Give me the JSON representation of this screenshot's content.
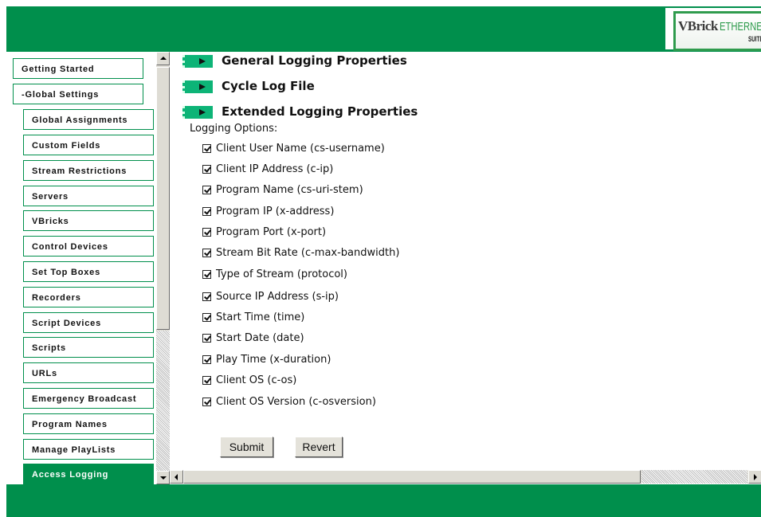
{
  "header": {
    "logo_brand": "VBrick",
    "logo_product": "ETHERNET",
    "logo_suite": "SUITE"
  },
  "sidebar": {
    "items": [
      {
        "label": "Getting Started"
      },
      {
        "label": "-Global Settings"
      },
      {
        "label": "Global Assignments"
      },
      {
        "label": "Custom Fields"
      },
      {
        "label": "Stream Restrictions"
      },
      {
        "label": "Servers"
      },
      {
        "label": "VBricks"
      },
      {
        "label": "Control Devices"
      },
      {
        "label": "Set Top Boxes"
      },
      {
        "label": "Recorders"
      },
      {
        "label": "Script Devices"
      },
      {
        "label": "Scripts"
      },
      {
        "label": "URLs"
      },
      {
        "label": "Emergency Broadcast"
      },
      {
        "label": "Program Names"
      },
      {
        "label": "Manage PlayLists"
      },
      {
        "label": "Access Logging"
      }
    ],
    "active_item": "Access Logging"
  },
  "sections": [
    {
      "title": "General Logging Properties"
    },
    {
      "title": "Cycle Log File"
    },
    {
      "title": "Extended Logging Properties"
    }
  ],
  "logging": {
    "label": "Logging Options:",
    "options": [
      {
        "label": "Client User Name (cs-username)",
        "checked": true
      },
      {
        "label": "Client IP Address (c-ip)",
        "checked": true
      },
      {
        "label": "Program Name (cs-uri-stem)",
        "checked": true
      },
      {
        "label": "Program IP (x-address)",
        "checked": true
      },
      {
        "label": "Program Port (x-port)",
        "checked": true
      },
      {
        "label": "Stream Bit Rate (c-max-bandwidth)",
        "checked": true
      },
      {
        "label": "Type of Stream (protocol)",
        "checked": true
      },
      {
        "label": "Source IP Address (s-ip)",
        "checked": true
      },
      {
        "label": "Start Time (time)",
        "checked": true
      },
      {
        "label": "Start Date (date)",
        "checked": true
      },
      {
        "label": "Play Time (x-duration)",
        "checked": true
      },
      {
        "label": "Client OS (c-os)",
        "checked": true
      },
      {
        "label": "Client OS Version (c-osversion)",
        "checked": true
      }
    ]
  },
  "buttons": {
    "submit": "Submit",
    "revert": "Revert"
  },
  "colors": {
    "brand_green": "#008f4c",
    "section_button_green": "#0db477"
  },
  "icons": {
    "section_expand": "play-arrow-icon",
    "scroll_up": "arrow-up-icon",
    "scroll_down": "arrow-down-icon",
    "scroll_left": "arrow-left-icon",
    "scroll_right": "arrow-right-icon"
  }
}
